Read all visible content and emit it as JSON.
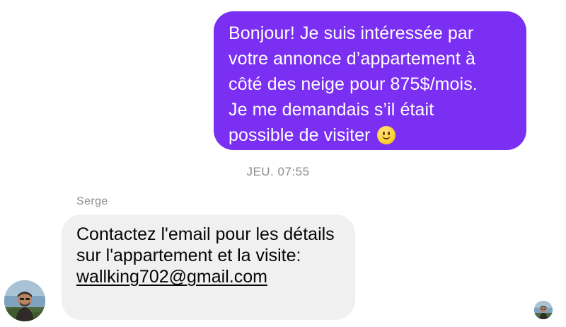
{
  "outgoing_message": {
    "lines": [
      "Bonjour! Je suis intéressée par",
      "votre annonce d’appartement à",
      "côté des neige pour 875$/mois.",
      "Je me demandais s’il était",
      "possible de visiter"
    ],
    "emoji": "slightly-smiling-face-icon"
  },
  "timestamp": "JEU. 07:55",
  "incoming_message": {
    "sender": "Serge",
    "text": "Contactez l'email pour les détails sur l'appartement et la visite:",
    "link": "wallking702@gmail.com"
  },
  "colors": {
    "outgoing_bubble": "#7a2ff3",
    "incoming_bubble": "#f0f0f0",
    "meta_text": "#8a8d91"
  }
}
